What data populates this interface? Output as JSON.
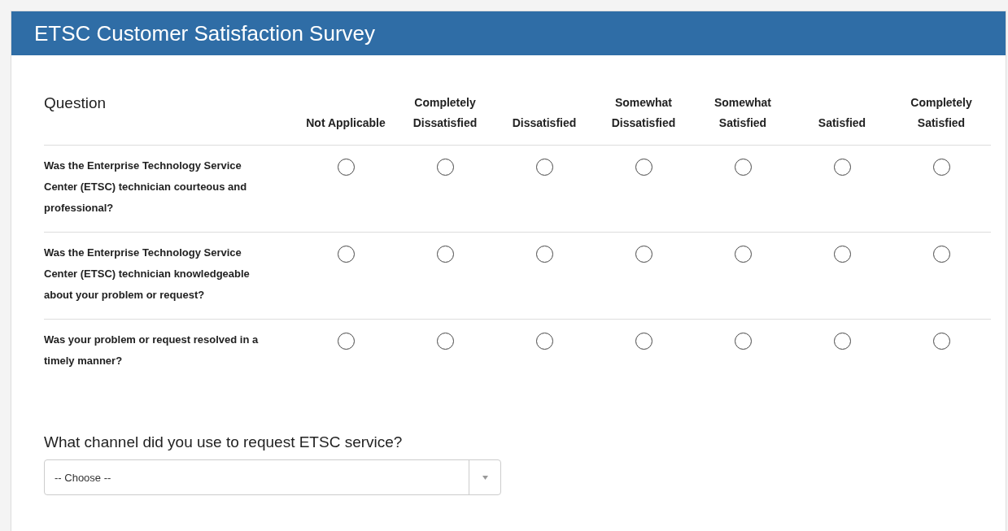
{
  "panel": {
    "title": "ETSC Customer Satisfaction Survey"
  },
  "table": {
    "question_heading": "Question",
    "columns": [
      [
        "Not Applicable"
      ],
      [
        "Completely",
        "Dissatisfied"
      ],
      [
        "Dissatisfied"
      ],
      [
        "Somewhat",
        "Dissatisfied"
      ],
      [
        "Somewhat",
        "Satisfied"
      ],
      [
        "Satisfied"
      ],
      [
        "Completely",
        "Satisfied"
      ]
    ],
    "rows": [
      {
        "question": "Was the Enterprise Technology Service Center (ETSC) technician courteous and professional?",
        "options": [
          {
            "selected": false
          },
          {
            "selected": false
          },
          {
            "selected": false
          },
          {
            "selected": false
          },
          {
            "selected": false
          },
          {
            "selected": false
          },
          {
            "selected": false
          }
        ]
      },
      {
        "question": "Was the Enterprise Technology Service Center (ETSC) technician knowledgeable about your problem or request?",
        "options": [
          {
            "selected": false
          },
          {
            "selected": false
          },
          {
            "selected": false
          },
          {
            "selected": false
          },
          {
            "selected": false
          },
          {
            "selected": false
          },
          {
            "selected": false
          }
        ]
      },
      {
        "question": "Was your problem or request resolved in a timely manner?",
        "options": [
          {
            "selected": false
          },
          {
            "selected": false
          },
          {
            "selected": false
          },
          {
            "selected": false
          },
          {
            "selected": false
          },
          {
            "selected": false
          },
          {
            "selected": false
          }
        ]
      }
    ]
  },
  "channel": {
    "label": "What channel did you use to request ETSC service?",
    "placeholder": "-- Choose --"
  }
}
